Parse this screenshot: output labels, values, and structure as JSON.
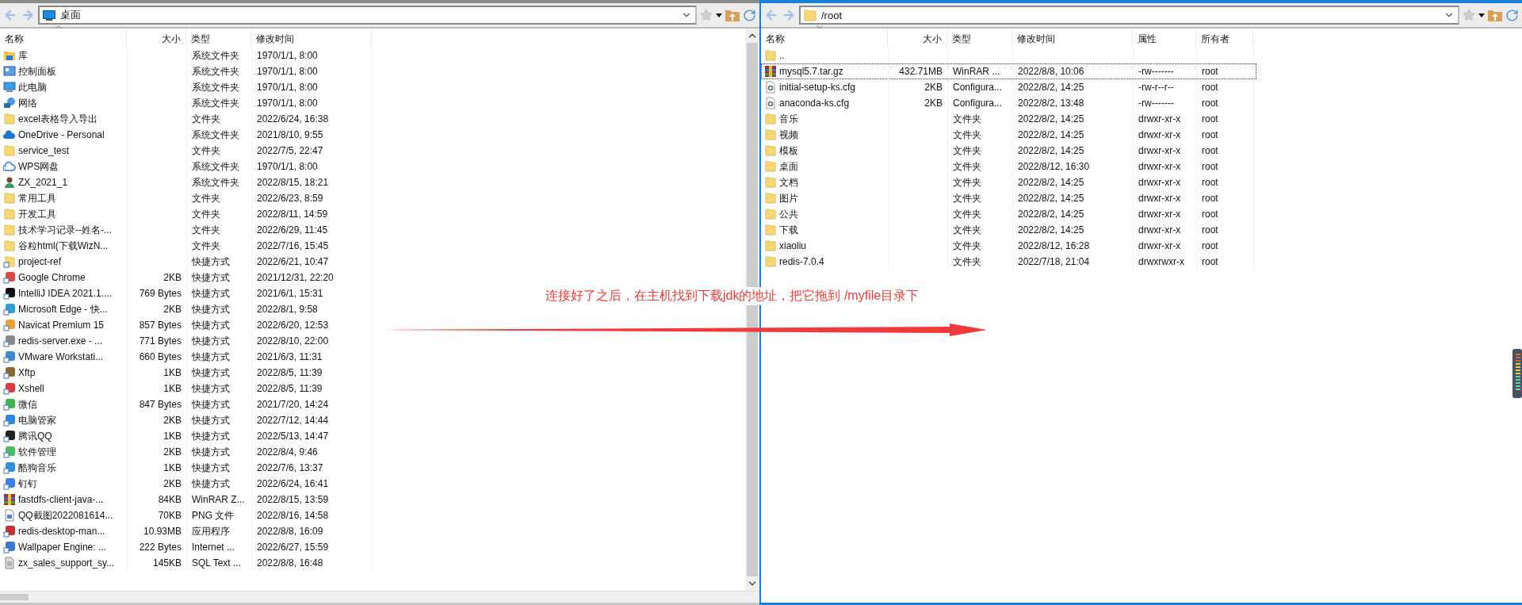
{
  "panes": [
    {
      "active": false,
      "path": "桌面",
      "columns": [
        "名称",
        "大小",
        "类型",
        "修改时间"
      ],
      "rows": [
        {
          "kind": "library",
          "cells": [
            "库",
            "",
            "系统文件夹",
            "1970/1/1, 8:00"
          ]
        },
        {
          "kind": "panel",
          "cells": [
            "控制面板",
            "",
            "系统文件夹",
            "1970/1/1, 8:00"
          ]
        },
        {
          "kind": "computer",
          "cells": [
            "此电脑",
            "",
            "系统文件夹",
            "1970/1/1, 8:00"
          ]
        },
        {
          "kind": "network",
          "cells": [
            "网络",
            "",
            "系统文件夹",
            "1970/1/1, 8:00"
          ]
        },
        {
          "kind": "folder",
          "cells": [
            "excel表格导入导出",
            "",
            "文件夹",
            "2022/6/24, 16:38"
          ]
        },
        {
          "kind": "cloud",
          "cells": [
            "OneDrive - Personal",
            "",
            "系统文件夹",
            "2021/8/10, 9:55"
          ]
        },
        {
          "kind": "folder",
          "cells": [
            "service_test",
            "",
            "文件夹",
            "2022/7/5, 22:47"
          ]
        },
        {
          "kind": "cloud-outline",
          "cells": [
            "WPS网盘",
            "",
            "系统文件夹",
            "1970/1/1, 8:00"
          ]
        },
        {
          "kind": "user",
          "cells": [
            "ZX_2021_1",
            "",
            "系统文件夹",
            "2022/8/15, 18:21"
          ]
        },
        {
          "kind": "folder",
          "cells": [
            "常用工具",
            "",
            "文件夹",
            "2022/6/23, 8:59"
          ]
        },
        {
          "kind": "folder",
          "cells": [
            "开发工具",
            "",
            "文件夹",
            "2022/8/11, 14:59"
          ]
        },
        {
          "kind": "folder",
          "cells": [
            "技术学习记录--姓名-...",
            "",
            "文件夹",
            "2022/6/29, 11:45"
          ]
        },
        {
          "kind": "folder",
          "cells": [
            "谷粒html(下载WizN...",
            "",
            "文件夹",
            "2022/7/16, 15:45"
          ]
        },
        {
          "kind": "folder-shortcut",
          "cells": [
            "project-ref",
            "",
            "快捷方式",
            "2022/6/21, 10:47"
          ]
        },
        {
          "kind": "app",
          "color": "#e04a3a",
          "cells": [
            "Google Chrome",
            "2KB",
            "快捷方式",
            "2021/12/31, 22:20"
          ]
        },
        {
          "kind": "app",
          "color": "#111111",
          "cells": [
            "IntelliJ IDEA 2021.1....",
            "769 Bytes",
            "快捷方式",
            "2021/6/1, 15:31"
          ]
        },
        {
          "kind": "app",
          "color": "#2a9fd8",
          "cells": [
            "Microsoft Edge - 快...",
            "2KB",
            "快捷方式",
            "2022/8/1, 9:58"
          ]
        },
        {
          "kind": "app",
          "color": "#f0a030",
          "cells": [
            "Navicat Premium 15",
            "857 Bytes",
            "快捷方式",
            "2022/6/20, 12:53"
          ]
        },
        {
          "kind": "app",
          "color": "#8a8a8a",
          "cells": [
            "redis-server.exe - ...",
            "771 Bytes",
            "快捷方式",
            "2022/8/10, 22:00"
          ]
        },
        {
          "kind": "app",
          "color": "#3a8ad8",
          "cells": [
            "VMware Workstati...",
            "660 Bytes",
            "快捷方式",
            "2021/6/3, 11:31"
          ]
        },
        {
          "kind": "app",
          "color": "#8a6a30",
          "cells": [
            "Xftp",
            "1KB",
            "快捷方式",
            "2022/8/5, 11:39"
          ]
        },
        {
          "kind": "app",
          "color": "#e03a3a",
          "cells": [
            "Xshell",
            "1KB",
            "快捷方式",
            "2022/8/5, 11:39"
          ]
        },
        {
          "kind": "app",
          "color": "#3ab84a",
          "cells": [
            "微信",
            "847 Bytes",
            "快捷方式",
            "2021/7/20, 14:24"
          ]
        },
        {
          "kind": "app",
          "color": "#2a8ae0",
          "cells": [
            "电脑管家",
            "2KB",
            "快捷方式",
            "2022/7/12, 14:44"
          ]
        },
        {
          "kind": "app",
          "color": "#222222",
          "cells": [
            "腾讯QQ",
            "1KB",
            "快捷方式",
            "2022/5/13, 14:47"
          ]
        },
        {
          "kind": "app",
          "color": "#48c060",
          "cells": [
            "软件管理",
            "2KB",
            "快捷方式",
            "2022/8/4, 9:46"
          ]
        },
        {
          "kind": "app",
          "color": "#2a90e0",
          "cells": [
            "酷狗音乐",
            "1KB",
            "快捷方式",
            "2022/7/6, 13:37"
          ]
        },
        {
          "kind": "app",
          "color": "#3a80e8",
          "cells": [
            "钉钉",
            "2KB",
            "快捷方式",
            "2022/6/24, 16:41"
          ]
        },
        {
          "kind": "archive",
          "cells": [
            "fastdfs-client-java-...",
            "84KB",
            "WinRAR Z...",
            "2022/8/15, 13:59"
          ]
        },
        {
          "kind": "image",
          "cells": [
            "QQ截图2022081614...",
            "70KB",
            "PNG 文件",
            "2022/8/16, 14:58"
          ]
        },
        {
          "kind": "app",
          "color": "#c8302a",
          "cells": [
            "redis-desktop-man...",
            "10.93MB",
            "应用程序",
            "2022/8/8, 16:09"
          ]
        },
        {
          "kind": "app",
          "color": "#3a7ad0",
          "cells": [
            "Wallpaper Engine: ...",
            "222 Bytes",
            "Internet ...",
            "2022/6/27, 15:59"
          ]
        },
        {
          "kind": "document",
          "cells": [
            "zx_sales_support_sy...",
            "145KB",
            "SQL Text ...",
            "2022/8/8, 16:48"
          ]
        }
      ]
    },
    {
      "active": true,
      "path": "/root",
      "columns": [
        "名称",
        "大小",
        "类型",
        "修改时间",
        "属性",
        "所有者"
      ],
      "rows": [
        {
          "kind": "folder",
          "selected": false,
          "cells": [
            "..",
            "",
            "",
            "",
            "",
            ""
          ]
        },
        {
          "kind": "archive",
          "selected": true,
          "cells": [
            "mysql5.7.tar.gz",
            "432.71MB",
            "WinRAR ...",
            "2022/8/8, 10:06",
            "-rw-------",
            "root"
          ]
        },
        {
          "kind": "config",
          "selected": false,
          "cells": [
            "initial-setup-ks.cfg",
            "2KB",
            "Configura...",
            "2022/8/2, 14:25",
            "-rw-r--r--",
            "root"
          ]
        },
        {
          "kind": "config",
          "selected": false,
          "cells": [
            "anaconda-ks.cfg",
            "2KB",
            "Configura...",
            "2022/8/2, 13:48",
            "-rw-------",
            "root"
          ]
        },
        {
          "kind": "folder",
          "selected": false,
          "cells": [
            "音乐",
            "",
            "文件夹",
            "2022/8/2, 14:25",
            "drwxr-xr-x",
            "root"
          ]
        },
        {
          "kind": "folder",
          "selected": false,
          "cells": [
            "视频",
            "",
            "文件夹",
            "2022/8/2, 14:25",
            "drwxr-xr-x",
            "root"
          ]
        },
        {
          "kind": "folder",
          "selected": false,
          "cells": [
            "模板",
            "",
            "文件夹",
            "2022/8/2, 14:25",
            "drwxr-xr-x",
            "root"
          ]
        },
        {
          "kind": "folder",
          "selected": false,
          "cells": [
            "桌面",
            "",
            "文件夹",
            "2022/8/12, 16:30",
            "drwxr-xr-x",
            "root"
          ]
        },
        {
          "kind": "folder",
          "selected": false,
          "cells": [
            "文档",
            "",
            "文件夹",
            "2022/8/2, 14:25",
            "drwxr-xr-x",
            "root"
          ]
        },
        {
          "kind": "folder",
          "selected": false,
          "cells": [
            "图片",
            "",
            "文件夹",
            "2022/8/2, 14:25",
            "drwxr-xr-x",
            "root"
          ]
        },
        {
          "kind": "folder",
          "selected": false,
          "cells": [
            "公共",
            "",
            "文件夹",
            "2022/8/2, 14:25",
            "drwxr-xr-x",
            "root"
          ]
        },
        {
          "kind": "folder",
          "selected": false,
          "cells": [
            "下载",
            "",
            "文件夹",
            "2022/8/2, 14:25",
            "drwxr-xr-x",
            "root"
          ]
        },
        {
          "kind": "folder",
          "selected": false,
          "cells": [
            "xiaoliu",
            "",
            "文件夹",
            "2022/8/12, 16:28",
            "drwxr-xr-x",
            "root"
          ]
        },
        {
          "kind": "folder",
          "selected": false,
          "cells": [
            "redis-7.0.4",
            "",
            "文件夹",
            "2022/7/18, 21:04",
            "drwxrwxr-x",
            "root"
          ]
        }
      ]
    }
  ],
  "annotation": {
    "text": "连接好了之后，在主机找到下载jdk的地址，把它拖到  /myfile目录下"
  }
}
